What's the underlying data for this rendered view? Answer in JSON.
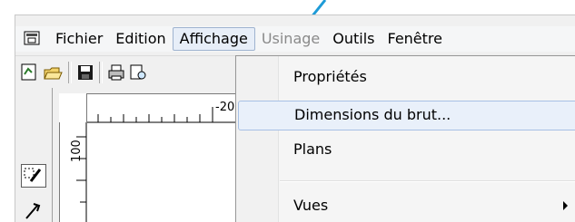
{
  "menubar": {
    "items": [
      {
        "label": "Fichier",
        "state": "normal"
      },
      {
        "label": "Edition",
        "state": "normal"
      },
      {
        "label": "Affichage",
        "state": "active"
      },
      {
        "label": "Usinage",
        "state": "disabled"
      },
      {
        "label": "Outils",
        "state": "normal"
      },
      {
        "label": "Fenêtre",
        "state": "normal"
      }
    ]
  },
  "dropdown": {
    "items": [
      {
        "label": "Propriétés"
      },
      {
        "label": "Dimensions du brut..."
      },
      {
        "label": "Plans"
      },
      {
        "label": "Vues"
      }
    ]
  },
  "ruler": {
    "h_label": "-20",
    "v_label": "100"
  },
  "colors": {
    "callout": "#1e9bd7",
    "highlight": "#e9f0fa",
    "highlight_border": "#a7c0e5"
  },
  "icons": [
    "app-window-icon",
    "new-document-icon",
    "open-folder-icon",
    "save-disk-icon",
    "print-icon",
    "preview-icon",
    "draw-pencil-icon",
    "curve-tool-icon",
    "submenu-arrow-icon"
  ]
}
